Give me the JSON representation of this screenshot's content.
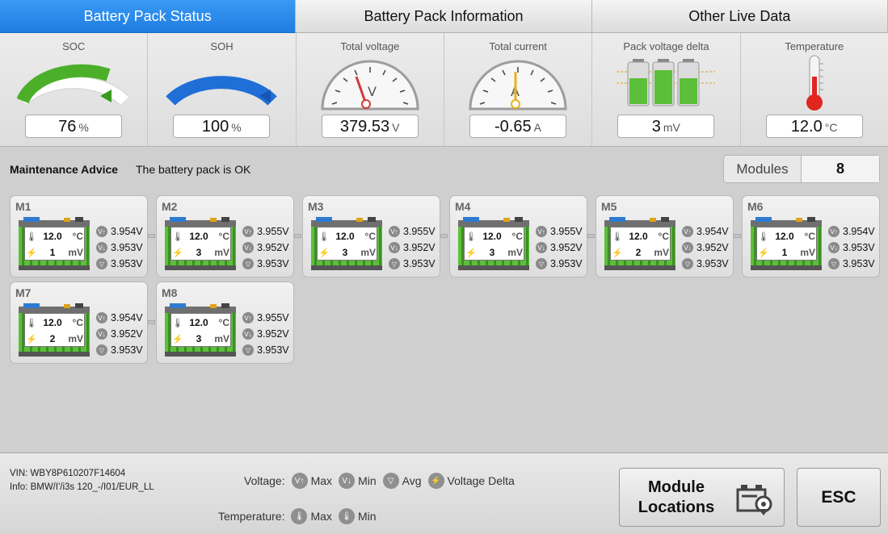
{
  "tabs": [
    {
      "label": "Battery Pack Status",
      "active": true
    },
    {
      "label": "Battery Pack Information",
      "active": false
    },
    {
      "label": "Other Live Data",
      "active": false
    }
  ],
  "gauges": {
    "soc": {
      "title": "SOC",
      "value": "76",
      "unit": "%",
      "percent": 76
    },
    "soh": {
      "title": "SOH",
      "value": "100",
      "unit": "%",
      "percent": 100
    },
    "voltage": {
      "title": "Total voltage",
      "value": "379.53",
      "unit": "V"
    },
    "current": {
      "title": "Total current",
      "value": "-0.65",
      "unit": "A"
    },
    "delta": {
      "title": "Pack voltage delta",
      "value": "3",
      "unit": "mV"
    },
    "temperature": {
      "title": "Temperature",
      "value": "12.0",
      "unit": "°C"
    }
  },
  "advice": {
    "title": "Maintenance Advice",
    "text": "The battery pack is OK"
  },
  "modules_count": {
    "label": "Modules",
    "value": "8"
  },
  "modules": [
    {
      "name": "M1",
      "temp": "12.0",
      "temp_unit": "°C",
      "delta": "1",
      "delta_unit": "mV",
      "vmax": "3.954V",
      "vmin": "3.953V",
      "vavg": "3.953V"
    },
    {
      "name": "M2",
      "temp": "12.0",
      "temp_unit": "°C",
      "delta": "3",
      "delta_unit": "mV",
      "vmax": "3.955V",
      "vmin": "3.952V",
      "vavg": "3.953V"
    },
    {
      "name": "M3",
      "temp": "12.0",
      "temp_unit": "°C",
      "delta": "3",
      "delta_unit": "mV",
      "vmax": "3.955V",
      "vmin": "3.952V",
      "vavg": "3.953V"
    },
    {
      "name": "M4",
      "temp": "12.0",
      "temp_unit": "°C",
      "delta": "3",
      "delta_unit": "mV",
      "vmax": "3.955V",
      "vmin": "3.952V",
      "vavg": "3.953V"
    },
    {
      "name": "M5",
      "temp": "12.0",
      "temp_unit": "°C",
      "delta": "2",
      "delta_unit": "mV",
      "vmax": "3.954V",
      "vmin": "3.952V",
      "vavg": "3.953V"
    },
    {
      "name": "M6",
      "temp": "12.0",
      "temp_unit": "°C",
      "delta": "1",
      "delta_unit": "mV",
      "vmax": "3.954V",
      "vmin": "3.953V",
      "vavg": "3.953V"
    },
    {
      "name": "M7",
      "temp": "12.0",
      "temp_unit": "°C",
      "delta": "2",
      "delta_unit": "mV",
      "vmax": "3.954V",
      "vmin": "3.952V",
      "vavg": "3.953V"
    },
    {
      "name": "M8",
      "temp": "12.0",
      "temp_unit": "°C",
      "delta": "3",
      "delta_unit": "mV",
      "vmax": "3.955V",
      "vmin": "3.952V",
      "vavg": "3.953V"
    }
  ],
  "footer": {
    "vin": "VIN: WBY8P610207F14604",
    "info": "Info: BMW/I'/i3s 120_-/I01/EUR_LL",
    "voltage_label": "Voltage:",
    "voltage_legend": [
      "Max",
      "Min",
      "Avg",
      "Voltage Delta"
    ],
    "temperature_label": "Temperature:",
    "temperature_legend": [
      "Max",
      "Min"
    ],
    "module_locations_label": "Module Locations",
    "esc_label": "ESC"
  },
  "colors": {
    "accent": "#1e7ce0",
    "soc_green": "#4caf2a",
    "soh_blue": "#1f6fd6",
    "cell_green": "#5cbf3a",
    "thermo_red": "#e0261f"
  },
  "icons": [
    "thermometer-icon",
    "bolt-icon",
    "vmax-icon",
    "vmin-icon",
    "vavg-icon",
    "voltage-delta-icon",
    "temp-max-icon",
    "temp-min-icon",
    "battery-location-icon"
  ]
}
